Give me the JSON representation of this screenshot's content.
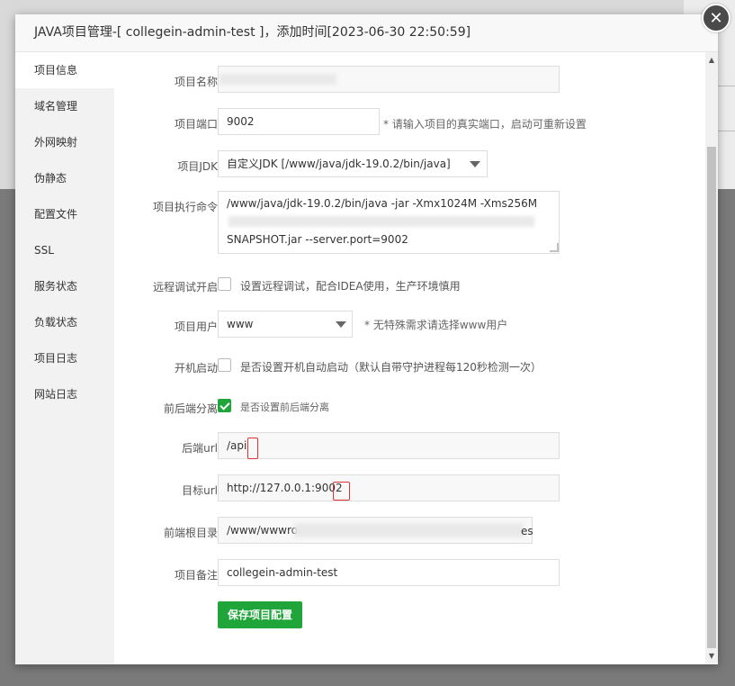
{
  "dialog": {
    "title": "JAVA项目管理-[ collegein-admin-test ]，添加时间[2023-06-30 22:50:59]",
    "close_icon": "close-icon"
  },
  "sidebar": {
    "items": [
      {
        "label": "项目信息",
        "active": true
      },
      {
        "label": "域名管理"
      },
      {
        "label": "外网映射"
      },
      {
        "label": "伪静态"
      },
      {
        "label": "配置文件"
      },
      {
        "label": "SSL"
      },
      {
        "label": "服务状态"
      },
      {
        "label": "负载状态"
      },
      {
        "label": "项目日志"
      },
      {
        "label": "网站日志"
      }
    ]
  },
  "form": {
    "name": {
      "label": "项目名称",
      "value": ""
    },
    "port": {
      "label": "项目端口",
      "value": "9002",
      "hint": "* 请输入项目的真实端口，启动可重新设置"
    },
    "jdk": {
      "label": "项目JDK",
      "value": "自定义JDK [/www/java/jdk-19.0.2/bin/java]"
    },
    "cmd": {
      "label": "项目执行命令",
      "line1": "/www/java/jdk-19.0.2/bin/java -jar -Xmx1024M -Xms256M",
      "line3": "SNAPSHOT.jar --server.port=9002"
    },
    "debug": {
      "label": "远程调试开启",
      "text": "设置远程调试，配合IDEA使用，生产环境慎用",
      "checked": false
    },
    "user": {
      "label": "项目用户",
      "value": "www",
      "hint": "* 无特殊需求请选择www用户"
    },
    "autostart": {
      "label": "开机启动",
      "text": "是否设置开机自动启动（默认自带守护进程每120秒检测一次）",
      "checked": false
    },
    "split": {
      "label": "前后端分离",
      "text": "是否设置前后端分离",
      "checked": true
    },
    "backend_url": {
      "label": "后端url",
      "value": "/api"
    },
    "target_url": {
      "label": "目标url",
      "value": "http://127.0.0.1:9002"
    },
    "frontend_root": {
      "label": "前端根目录",
      "value_prefix": "/www/wwwro",
      "value_suffix": "es"
    },
    "remark": {
      "label": "项目备注",
      "value": "collegein-admin-test"
    },
    "save_label": "保存项目配置"
  },
  "colors": {
    "accent": "#20a53a",
    "close_bg": "#4a4a4a"
  }
}
